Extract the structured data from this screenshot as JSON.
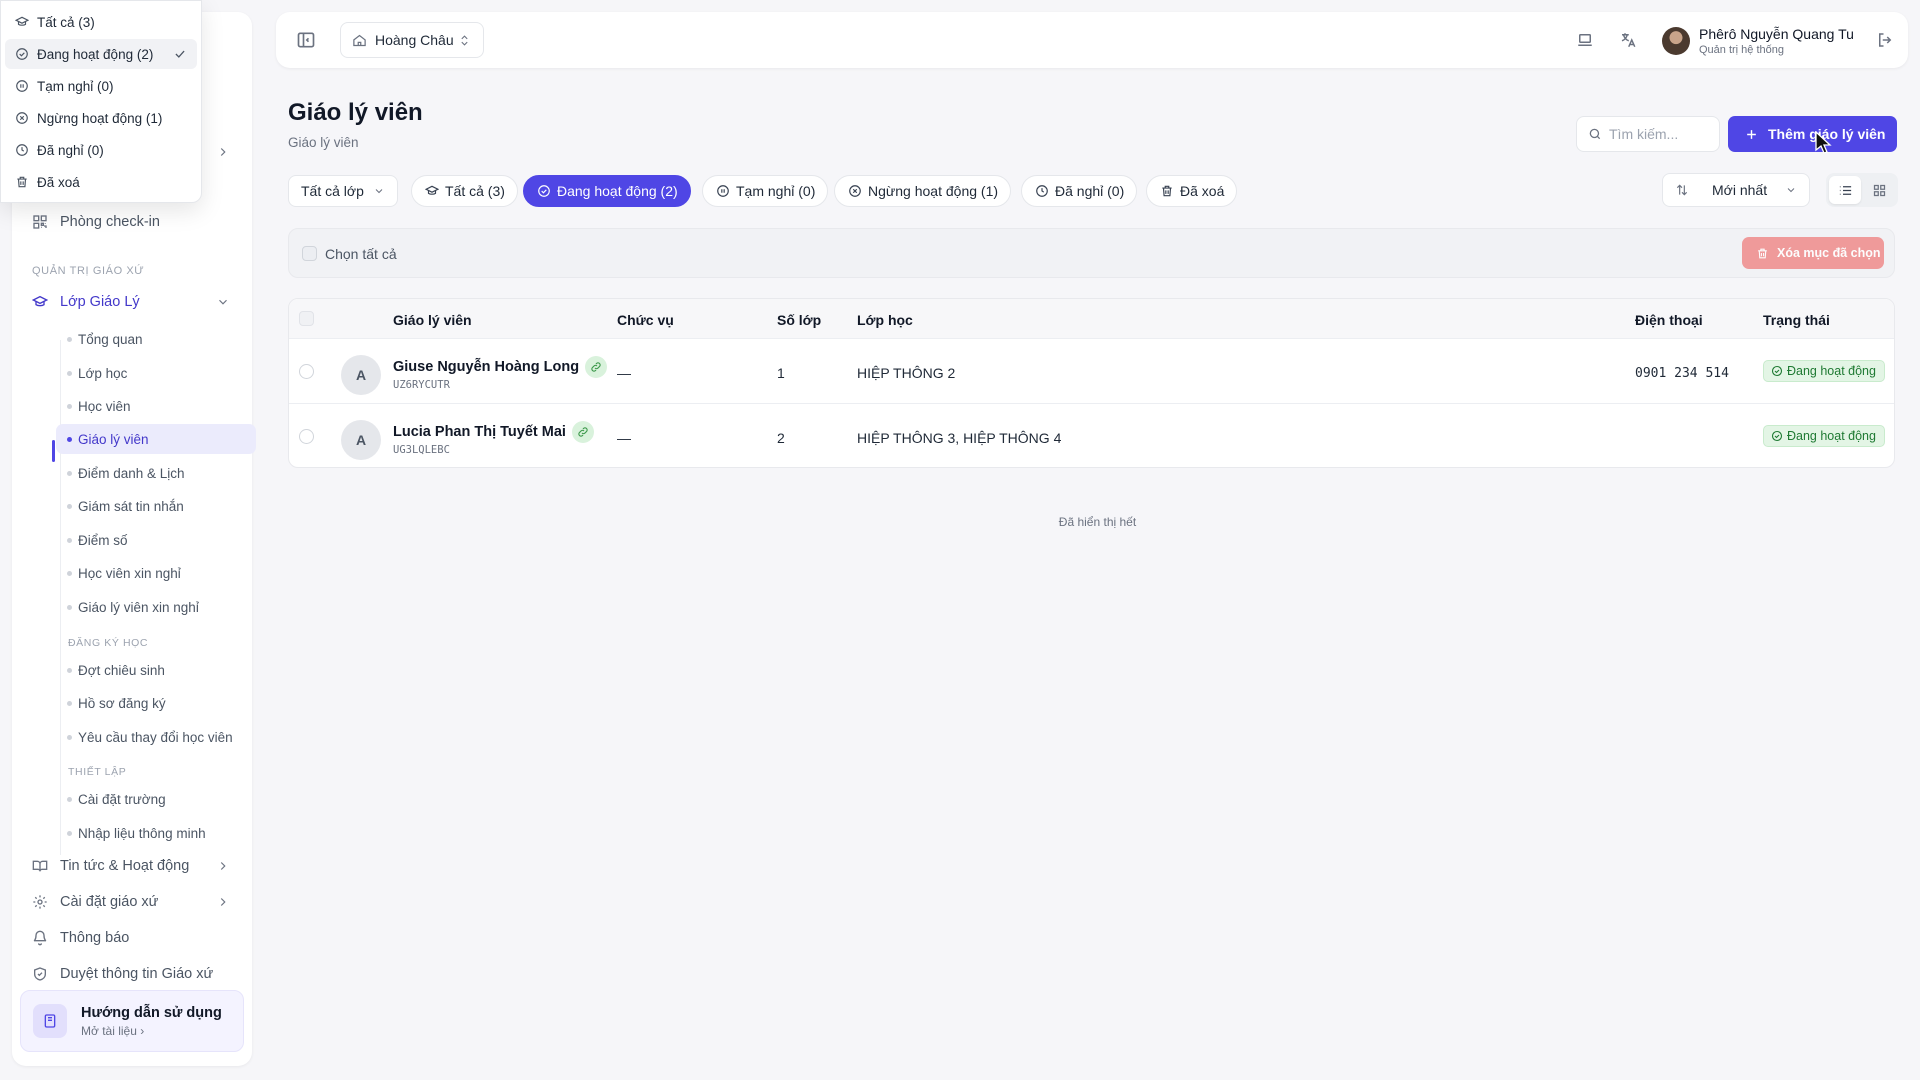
{
  "sidebar": {
    "checkin": "Phòng check-in",
    "section_admin": "QUẢN TRỊ GIÁO XỨ",
    "class_group": "Lớp Giáo Lý",
    "sub_items": [
      "Tổng quan",
      "Lớp học",
      "Học viên",
      "Giáo lý viên",
      "Điểm danh & Lịch",
      "Giám sát tin nhắn",
      "Điểm số",
      "Học viên xin nghỉ",
      "Giáo lý viên xin nghỉ"
    ],
    "section_enroll": "ĐĂNG KÝ HỌC",
    "enroll_items": [
      "Đợt chiêu sinh",
      "Hồ sơ đăng ký",
      "Yêu cầu thay đổi học viên"
    ],
    "section_setup": "THIẾT LẬP",
    "setup_items": [
      "Cài đặt trường",
      "Nhập liệu thông minh"
    ],
    "news": "Tin tức & Hoạt động",
    "parish_settings": "Cài đặt giáo xứ",
    "notifications": "Thông báo",
    "approve_parish": "Duyệt thông tin Giáo xứ",
    "guide_title": "Hướng dẫn sử dụng",
    "guide_sub": "Mở tài liệu"
  },
  "status_popup": {
    "items": [
      {
        "label": "Tất cả (3)",
        "icon": "graduation-cap-icon"
      },
      {
        "label": "Đang hoạt động (2)",
        "icon": "check-circle-icon",
        "selected": true
      },
      {
        "label": "Tạm nghỉ (0)",
        "icon": "pause-circle-icon"
      },
      {
        "label": "Ngừng hoạt động (1)",
        "icon": "x-circle-icon"
      },
      {
        "label": "Đã nghỉ (0)",
        "icon": "clock-icon"
      },
      {
        "label": "Đã xoá",
        "icon": "trash-icon"
      }
    ]
  },
  "topbar": {
    "parish": "Hoàng Châu",
    "user_name": "Phêrô Nguyễn Quang Tu",
    "user_role": "Quản trị hệ thống"
  },
  "page": {
    "title": "Giáo lý viên",
    "subtitle": "Giáo lý viên",
    "search_placeholder": "Tìm kiếm...",
    "add_button": "Thêm giáo lý viên",
    "class_filter": "Tất cả lớp",
    "chips": [
      {
        "label": "Tất cả (3)",
        "icon": "graduation-cap-icon"
      },
      {
        "label": "Đang hoạt động (2)",
        "icon": "check-circle-icon",
        "active": true
      },
      {
        "label": "Tạm nghỉ (0)",
        "icon": "pause-circle-icon"
      },
      {
        "label": "Ngừng hoạt động (1)",
        "icon": "x-circle-icon"
      },
      {
        "label": "Đã nghỉ (0)",
        "icon": "clock-icon"
      },
      {
        "label": "Đã xoá",
        "icon": "trash-icon"
      }
    ],
    "sort": "Mới nhất",
    "select_all": "Chọn tất cả",
    "delete_selected": "Xóa mục đã chọn",
    "end_note": "Đã hiển thị hết"
  },
  "table": {
    "headers": {
      "teacher": "Giáo lý viên",
      "position": "Chức vụ",
      "class_count": "Số lớp",
      "classes": "Lớp học",
      "phone": "Điện thoại",
      "status": "Trạng thái"
    },
    "rows": [
      {
        "initial": "A",
        "name": "Giuse Nguyễn Hoàng Long",
        "code": "UZ6RYCUTR",
        "position": "—",
        "class_count": "1",
        "classes": "HIỆP THÔNG 2",
        "phone": "0901 234 514",
        "status": "Đang hoạt động"
      },
      {
        "initial": "A",
        "name": "Lucia Phan Thị Tuyết Mai",
        "code": "UG3LQLEBC",
        "position": "—",
        "class_count": "2",
        "classes": "HIỆP THÔNG 3, HIỆP THÔNG 4",
        "phone": "",
        "status": "Đang hoạt động"
      }
    ]
  },
  "colors": {
    "accent": "#4f46e5",
    "status_green": "#1f7a33",
    "danger": "#ef8b8b"
  }
}
